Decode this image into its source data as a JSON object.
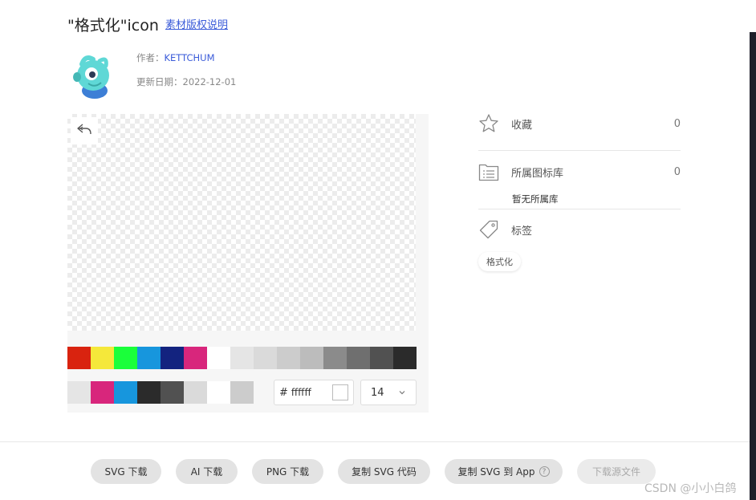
{
  "header": {
    "title": "\"格式化\"icon",
    "copyright_link": "素材版权说明"
  },
  "meta": {
    "author_label": "作者：",
    "author_name": "KETTCHUM",
    "date_label": "更新日期：",
    "date_value": "2022-12-01"
  },
  "editor": {
    "palette_row1": [
      "#d9230f",
      "#f5e83a",
      "#1aff3a",
      "#1796dd",
      "#13237f",
      "#d8267c",
      "#ffffff",
      "#e5e5e5",
      "#dadada",
      "#cccccc",
      "#bcbcbc",
      "#8b8b8b",
      "#6f6f6f",
      "#515151",
      "#2b2b2b"
    ],
    "palette_row2": [
      "#e5e5e5",
      "#d8267c",
      "#1796dd",
      "#2b2b2b",
      "#515151",
      "#dadada",
      "#ffffff",
      "#cccccc"
    ],
    "color_hash": "#",
    "color_value": "ffffff",
    "size_value": "14",
    "undo_icon": "undo-icon",
    "dropdown_icon": "chevron-down-icon"
  },
  "side": {
    "favorite_label": "收藏",
    "favorite_count": "0",
    "library_label": "所属图标库",
    "library_count": "0",
    "no_library": "暂无所属库",
    "tags_label": "标签",
    "tag": "格式化"
  },
  "actions": {
    "svg_download": "SVG 下载",
    "ai_download": "AI 下载",
    "png_download": "PNG 下载",
    "copy_svg_code": "复制 SVG 代码",
    "copy_svg_app": "复制 SVG 到 App",
    "help_glyph": "?",
    "source_download": "下载源文件"
  },
  "watermark": "CSDN @小小白鸽"
}
